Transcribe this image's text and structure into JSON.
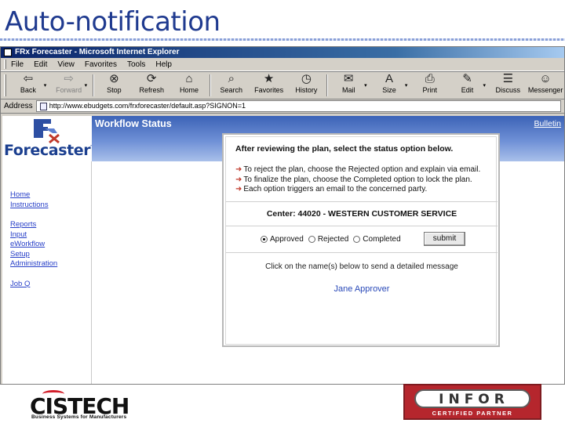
{
  "slide": {
    "title": "Auto-notification"
  },
  "browser": {
    "window_title": "FRx Forecaster - Microsoft Internet Explorer",
    "menu": [
      "File",
      "Edit",
      "View",
      "Favorites",
      "Tools",
      "Help"
    ],
    "toolbar": [
      {
        "label": "Back",
        "icon": "back-arrow-icon",
        "glyph": "⇦",
        "enabled": true
      },
      {
        "label": "Forward",
        "icon": "forward-arrow-icon",
        "glyph": "⇨",
        "enabled": false
      },
      {
        "label": "Stop",
        "icon": "stop-icon",
        "glyph": "⊗",
        "enabled": true
      },
      {
        "label": "Refresh",
        "icon": "refresh-icon",
        "glyph": "⟳",
        "enabled": true
      },
      {
        "label": "Home",
        "icon": "home-icon",
        "glyph": "⌂",
        "enabled": true
      },
      {
        "label": "Search",
        "icon": "search-icon",
        "glyph": "⌕",
        "enabled": true
      },
      {
        "label": "Favorites",
        "icon": "favorites-icon",
        "glyph": "★",
        "enabled": true
      },
      {
        "label": "History",
        "icon": "history-icon",
        "glyph": "◷",
        "enabled": true
      },
      {
        "label": "Mail",
        "icon": "mail-icon",
        "glyph": "✉",
        "enabled": true
      },
      {
        "label": "Size",
        "icon": "text-size-icon",
        "glyph": "A",
        "enabled": true
      },
      {
        "label": "Print",
        "icon": "print-icon",
        "glyph": "⎙",
        "enabled": true
      },
      {
        "label": "Edit",
        "icon": "edit-icon",
        "glyph": "✎",
        "enabled": true
      },
      {
        "label": "Discuss",
        "icon": "discuss-icon",
        "glyph": "☰",
        "enabled": true
      },
      {
        "label": "Messenger",
        "icon": "messenger-icon",
        "glyph": "☺",
        "enabled": true
      }
    ],
    "address_label": "Address",
    "address_url": "http://www.ebudgets.com/frxforecaster/default.asp?SIGNON=1"
  },
  "app": {
    "logo_text": "Forecaster",
    "logo_tm": "TM",
    "logo_mark": "FRx",
    "nav_group1": [
      "Home",
      "Instructions"
    ],
    "nav_group2": [
      "Reports",
      "Input",
      "eWorkflow",
      "Setup",
      "Administration"
    ],
    "nav_group3": [
      "Job Q"
    ],
    "banner_title": "Workflow Status",
    "bulletin_link": "Bulletin"
  },
  "panel": {
    "heading": "After reviewing the plan, select the status option below.",
    "steps": [
      "To reject the plan, choose the Rejected option and explain via email.",
      "To finalize the plan, choose the Completed option to lock the plan.",
      "Each option triggers an email to the concerned party."
    ],
    "center": "Center: 44020 - WESTERN CUSTOMER SERVICE",
    "options": [
      {
        "label": "Approved",
        "selected": true
      },
      {
        "label": "Rejected",
        "selected": false
      },
      {
        "label": "Completed",
        "selected": false
      }
    ],
    "submit_label": "submit",
    "message": "Click on the name(s) below to send a detailed message",
    "recipient": "Jane Approver"
  },
  "footer": {
    "cistech_name": "CISTECH",
    "cistech_tagline": "Business Systems for Manufacturers",
    "infor_name": "INFOR",
    "infor_badge": "CERTIFIED PARTNER"
  }
}
